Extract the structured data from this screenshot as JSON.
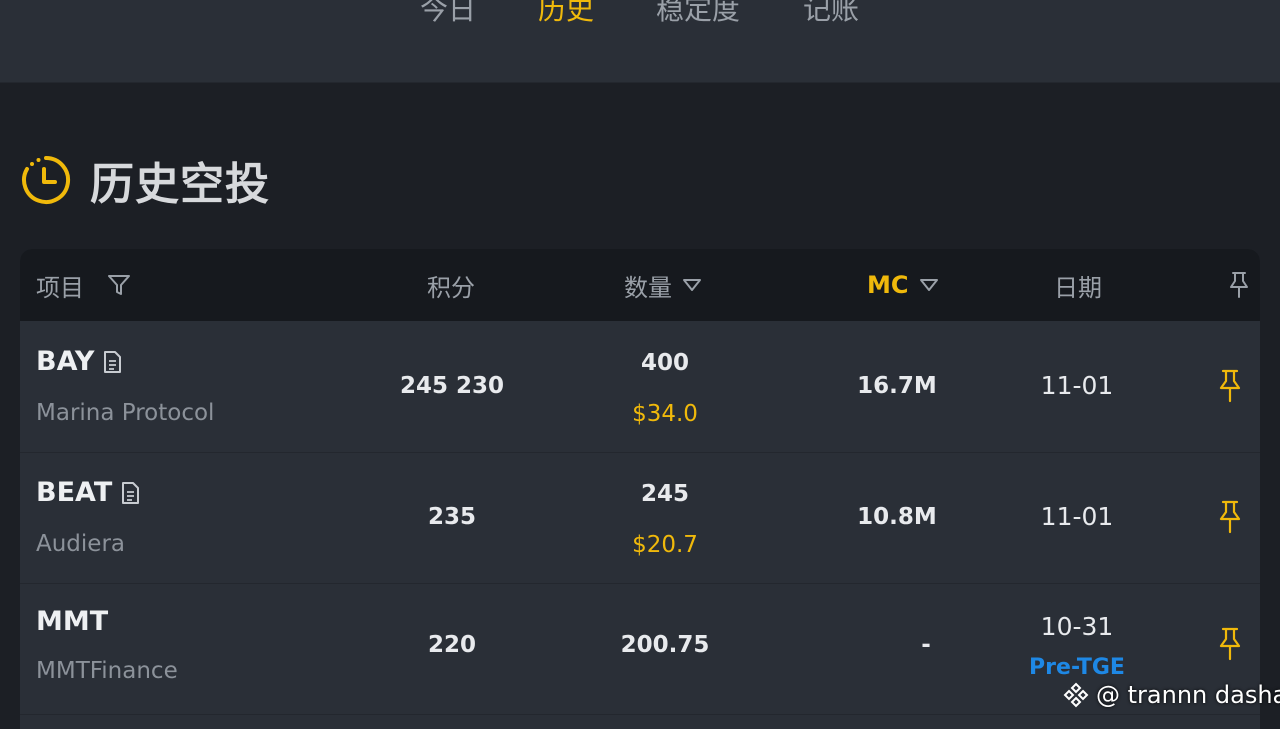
{
  "tabs": [
    "今日",
    "历史",
    "稳定度",
    "记账"
  ],
  "active_tab": "历史",
  "section": {
    "title": "历史空投",
    "icon": "clock-icon"
  },
  "table": {
    "headers": {
      "project": "项目",
      "points": "积分",
      "amount": "数量",
      "mc": "MC",
      "date": "日期"
    },
    "rows": [
      {
        "symbol": "BAY",
        "name": "Marina Protocol",
        "points": "245 230",
        "amount": "400",
        "usd": "$34.0",
        "mc": "16.7M",
        "date": "11-01",
        "has_doc": true
      },
      {
        "symbol": "BEAT",
        "name": "Audiera",
        "points": "235",
        "amount": "245",
        "usd": "$20.7",
        "mc": "10.8M",
        "date": "11-01",
        "has_doc": true
      },
      {
        "symbol": "MMT",
        "name": "MMTFinance",
        "points": "220",
        "amount": "200.75",
        "usd": "",
        "mc": "-",
        "date": "10-31",
        "tag": "Pre-TGE",
        "has_doc": false
      }
    ]
  },
  "watermark": "@ trannn dasha",
  "colors": {
    "accent": "#f0b90b",
    "link": "#1e88e5",
    "bg": "#1c1f25",
    "row_bg": "#2a2f37",
    "header_bg": "#16191e"
  }
}
